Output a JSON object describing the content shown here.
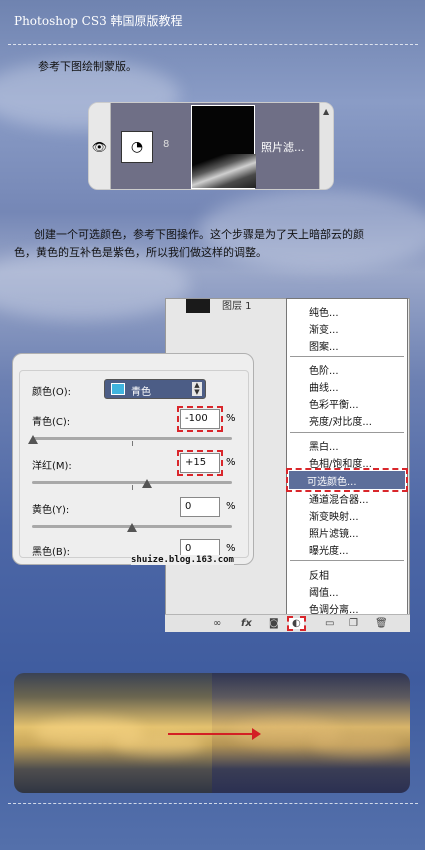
{
  "header": {
    "title": "Photoshop CS3 韩国原版教程"
  },
  "step1": {
    "text": "参考下图绘制蒙版。"
  },
  "layer": {
    "name": "照片滤..."
  },
  "step2": {
    "line1": "创建一个可选颜色，参考下图操作。这个步骤是为了天上暗部云的颜",
    "line2": "色，黄色的互补色是紫色，所以我们做这样的调整。"
  },
  "panel_header": "图层 1",
  "adjust_menu": {
    "items": [
      "纯色...",
      "渐变...",
      "图案...",
      "色阶...",
      "曲线...",
      "色彩平衡...",
      "亮度/对比度...",
      "黑白...",
      "色相/饱和度...",
      "可选颜色...",
      "通道混合器...",
      "渐变映射...",
      "照片滤镜...",
      "曝光度...",
      "反相",
      "阈值...",
      "色调分离..."
    ],
    "highlighted": "可选颜色..."
  },
  "dialog": {
    "colors_label": "颜色(O):",
    "colors_value": "青色",
    "swatch_color": "#40b4de",
    "sliders": [
      {
        "label": "青色(C):",
        "value": "-100",
        "unit": "%"
      },
      {
        "label": "洋红(M):",
        "value": "+15",
        "unit": "%"
      },
      {
        "label": "黄色(Y):",
        "value": "0",
        "unit": "%"
      },
      {
        "label": "黑色(B):",
        "value": "0",
        "unit": "%"
      }
    ],
    "credit": "shuize.blog.163.com"
  },
  "icons": [
    "eye-icon",
    "adjustment-layer-icon",
    "link-icon",
    "fx-icon",
    "mask-icon",
    "new-adjustment-layer-icon",
    "folder-icon",
    "new-layer-icon",
    "trash-icon"
  ],
  "accent_color": "#d9262b"
}
